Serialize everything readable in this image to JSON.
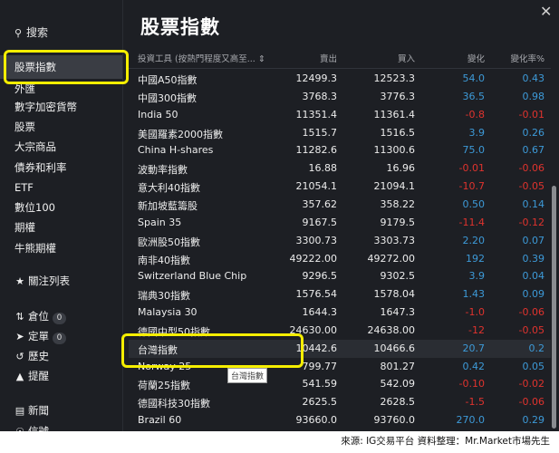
{
  "sidebar": {
    "search_label": "搜索",
    "items": [
      {
        "label": "股票指數",
        "active": true
      },
      {
        "label": "外匯"
      },
      {
        "label": "數字加密貨幣"
      },
      {
        "label": "股票"
      },
      {
        "label": "大宗商品"
      },
      {
        "label": "債券和利率"
      },
      {
        "label": "ETF"
      },
      {
        "label": "數位100"
      },
      {
        "label": "期權"
      },
      {
        "label": "牛熊期權"
      }
    ],
    "watchlist_label": "關注列表",
    "positions_label": "倉位",
    "positions_count": "0",
    "orders_label": "定單",
    "orders_count": "0",
    "history_label": "歷史",
    "alerts_label": "提醒",
    "news_label": "新聞",
    "more_label": "信號"
  },
  "page": {
    "title": "股票指數",
    "tooltip": "台灣指數",
    "source": "來源: IG交易平台  資料整理：Mr.Market市場先生"
  },
  "table": {
    "headers": {
      "name": "投資工具 (按熱門程度又高至...",
      "sell": "賣出",
      "buy": "買入",
      "change": "變化",
      "pct": "變化率%"
    },
    "rows": [
      {
        "name": "中國A50指數",
        "sell": "12499.3",
        "buy": "12523.3",
        "change": "54.0",
        "pct": "0.43",
        "dir": "pos"
      },
      {
        "name": "中國300指數",
        "sell": "3768.3",
        "buy": "3776.3",
        "change": "36.5",
        "pct": "0.98",
        "dir": "pos"
      },
      {
        "name": "India 50",
        "sell": "11351.4",
        "buy": "11361.4",
        "change": "-0.8",
        "pct": "-0.01",
        "dir": "neg"
      },
      {
        "name": "美國羅素2000指數",
        "sell": "1515.7",
        "buy": "1516.5",
        "change": "3.9",
        "pct": "0.26",
        "dir": "pos"
      },
      {
        "name": "China H-shares",
        "sell": "11282.6",
        "buy": "11300.6",
        "change": "75.0",
        "pct": "0.67",
        "dir": "pos"
      },
      {
        "name": "波動率指數",
        "sell": "16.88",
        "buy": "16.96",
        "change": "-0.01",
        "pct": "-0.06",
        "dir": "neg"
      },
      {
        "name": "意大利40指數",
        "sell": "21054.1",
        "buy": "21094.1",
        "change": "-10.7",
        "pct": "-0.05",
        "dir": "neg"
      },
      {
        "name": "新加坡藍籌股",
        "sell": "357.62",
        "buy": "358.22",
        "change": "0.50",
        "pct": "0.14",
        "dir": "pos"
      },
      {
        "name": "Spain 35",
        "sell": "9167.5",
        "buy": "9179.5",
        "change": "-11.4",
        "pct": "-0.12",
        "dir": "neg"
      },
      {
        "name": "歐洲股50指數",
        "sell": "3300.73",
        "buy": "3303.73",
        "change": "2.20",
        "pct": "0.07",
        "dir": "pos"
      },
      {
        "name": "南非40指數",
        "sell": "49222.00",
        "buy": "49272.00",
        "change": "192",
        "pct": "0.39",
        "dir": "pos"
      },
      {
        "name": "Switzerland Blue Chip",
        "sell": "9296.5",
        "buy": "9302.5",
        "change": "3.9",
        "pct": "0.04",
        "dir": "pos"
      },
      {
        "name": "瑞典30指數",
        "sell": "1576.54",
        "buy": "1578.04",
        "change": "1.43",
        "pct": "0.09",
        "dir": "pos"
      },
      {
        "name": "Malaysia 30",
        "sell": "1644.3",
        "buy": "1647.3",
        "change": "-1.0",
        "pct": "-0.06",
        "dir": "neg"
      },
      {
        "name": "德國中型50指數",
        "sell": "24630.00",
        "buy": "24638.00",
        "change": "-12",
        "pct": "-0.05",
        "dir": "neg"
      },
      {
        "name": "台灣指數",
        "sell": "10442.6",
        "buy": "10466.6",
        "change": "20.7",
        "pct": "0.2",
        "dir": "pos"
      },
      {
        "name": "Norway 25",
        "sell": "799.77",
        "buy": "801.27",
        "change": "0.42",
        "pct": "0.05",
        "dir": "pos"
      },
      {
        "name": "荷蘭25指數",
        "sell": "541.59",
        "buy": "542.09",
        "change": "-0.10",
        "pct": "-0.02",
        "dir": "neg"
      },
      {
        "name": "德國科技30指數",
        "sell": "2625.5",
        "buy": "2628.5",
        "change": "-1.5",
        "pct": "-0.06",
        "dir": "neg"
      },
      {
        "name": "Brazil 60",
        "sell": "93660.0",
        "buy": "93760.0",
        "change": "270.0",
        "pct": "0.29",
        "dir": "pos"
      }
    ]
  },
  "colors": {
    "highlight": "#f5ee00",
    "positive": "#3d9ad8",
    "negative": "#e0332e",
    "background": "#1d1f24"
  }
}
